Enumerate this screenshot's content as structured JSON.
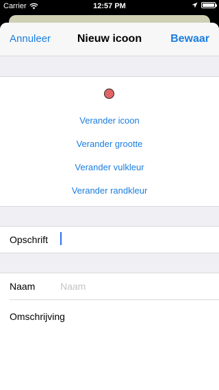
{
  "status_bar": {
    "carrier": "Carrier",
    "time": "12:57 PM"
  },
  "navbar": {
    "cancel_label": "Annuleer",
    "title": "Nieuw icoon",
    "save_label": "Bewaar"
  },
  "icon_preview": {
    "fill_color": "#e26465",
    "border_color": "#222222"
  },
  "actions": [
    {
      "label": "Verander icoon"
    },
    {
      "label": "Verander grootte"
    },
    {
      "label": "Verander vulkleur"
    },
    {
      "label": "Verander randkleur"
    }
  ],
  "caption_field": {
    "label": "Opschrift",
    "value": ""
  },
  "name_field": {
    "label": "Naam",
    "placeholder": "Naam",
    "value": ""
  },
  "description_field": {
    "label": "Omschrijving",
    "value": ""
  },
  "colors": {
    "accent": "#1a7ee0",
    "background": "#efeff4"
  }
}
